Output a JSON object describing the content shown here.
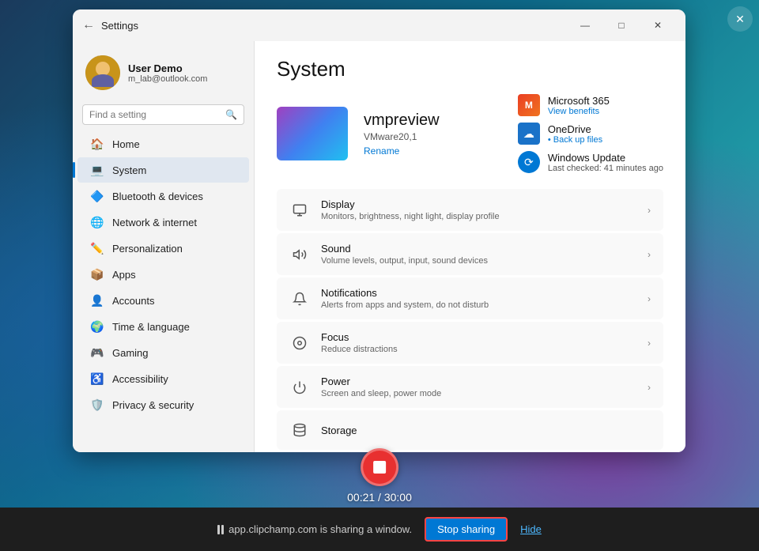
{
  "background": {
    "gradient": "dark teal to purple"
  },
  "corner_close": {
    "label": "✕"
  },
  "settings_window": {
    "title_bar": {
      "back_label": "←",
      "title": "Settings",
      "minimize_label": "—",
      "maximize_label": "□",
      "close_label": "✕"
    },
    "sidebar": {
      "user": {
        "name": "User Demo",
        "email": "m_lab@outlook.com"
      },
      "search": {
        "placeholder": "Find a setting"
      },
      "nav_items": [
        {
          "id": "home",
          "label": "Home",
          "icon": "🏠",
          "active": false
        },
        {
          "id": "system",
          "label": "System",
          "icon": "💻",
          "active": true
        },
        {
          "id": "bluetooth",
          "label": "Bluetooth & devices",
          "icon": "🔷",
          "active": false
        },
        {
          "id": "network",
          "label": "Network & internet",
          "icon": "🌐",
          "active": false
        },
        {
          "id": "personalization",
          "label": "Personalization",
          "icon": "✏️",
          "active": false
        },
        {
          "id": "apps",
          "label": "Apps",
          "icon": "📦",
          "active": false
        },
        {
          "id": "accounts",
          "label": "Accounts",
          "icon": "👤",
          "active": false
        },
        {
          "id": "time",
          "label": "Time & language",
          "icon": "🌍",
          "active": false
        },
        {
          "id": "gaming",
          "label": "Gaming",
          "icon": "🎮",
          "active": false
        },
        {
          "id": "accessibility",
          "label": "Accessibility",
          "icon": "♿",
          "active": false
        },
        {
          "id": "privacy",
          "label": "Privacy & security",
          "icon": "🛡️",
          "active": false
        }
      ]
    },
    "main": {
      "page_title": "System",
      "device": {
        "name": "vmpreview",
        "model": "VMware20,1",
        "rename_label": "Rename"
      },
      "quick_links": [
        {
          "id": "m365",
          "title": "Microsoft 365",
          "sub": "View benefits",
          "sub_color": "blue"
        },
        {
          "id": "onedrive",
          "title": "OneDrive",
          "sub": "• Back up files",
          "sub_color": "blue"
        },
        {
          "id": "winupdate",
          "title": "Windows Update",
          "sub": "Last checked: 41 minutes ago",
          "sub_color": "gray"
        }
      ],
      "settings_items": [
        {
          "id": "display",
          "title": "Display",
          "sub": "Monitors, brightness, night light, display profile",
          "icon": "🖥"
        },
        {
          "id": "sound",
          "title": "Sound",
          "sub": "Volume levels, output, input, sound devices",
          "icon": "🔊"
        },
        {
          "id": "notifications",
          "title": "Notifications",
          "sub": "Alerts from apps and system, do not disturb",
          "icon": "🔔"
        },
        {
          "id": "focus",
          "title": "Focus",
          "sub": "Reduce distractions",
          "icon": "⏰"
        },
        {
          "id": "power",
          "title": "Power",
          "sub": "Screen and sleep, power mode",
          "icon": "⏻"
        },
        {
          "id": "storage",
          "title": "Storage",
          "sub": "",
          "icon": "💾"
        }
      ]
    }
  },
  "recording": {
    "timer": "00:21 / 30:00"
  },
  "sharing_bar": {
    "sharing_text": "app.clipchamp.com is sharing a window.",
    "stop_sharing_label": "Stop sharing",
    "hide_label": "Hide"
  }
}
